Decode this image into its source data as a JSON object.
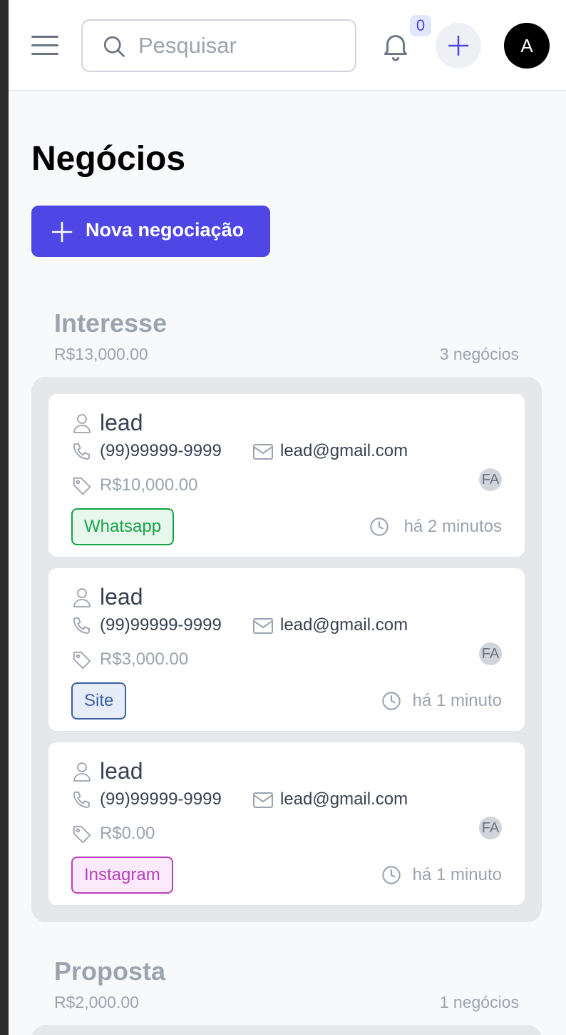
{
  "topbar": {
    "search_placeholder": "Pesquisar",
    "notification_count": "0",
    "avatar_initial": "A"
  },
  "page": {
    "title": "Negócios",
    "new_deal_label": "Nova negociação"
  },
  "colors": {
    "primary": "#4f46e5",
    "whatsapp": "#16a34a",
    "site": "#3b5fa0",
    "instagram": "#b83fb8"
  },
  "stages": [
    {
      "title": "Interesse",
      "total": "R$13,000.00",
      "count": "3 negócios",
      "deals": [
        {
          "name": "lead",
          "phone": "(99)99999-9999",
          "email": "lead@gmail.com",
          "value": "R$10,000.00",
          "owner": "FA",
          "source": "Whatsapp",
          "time": "há 2 minutos"
        },
        {
          "name": "lead",
          "phone": "(99)99999-9999",
          "email": "lead@gmail.com",
          "value": "R$3,000.00",
          "owner": "FA",
          "source": "Site",
          "time": "há 1 minuto"
        },
        {
          "name": "lead",
          "phone": "(99)99999-9999",
          "email": "lead@gmail.com",
          "value": "R$0.00",
          "owner": "FA",
          "source": "Instagram",
          "time": "há 1 minuto"
        }
      ]
    },
    {
      "title": "Proposta",
      "total": "R$2,000.00",
      "count": "1 negócios"
    }
  ]
}
